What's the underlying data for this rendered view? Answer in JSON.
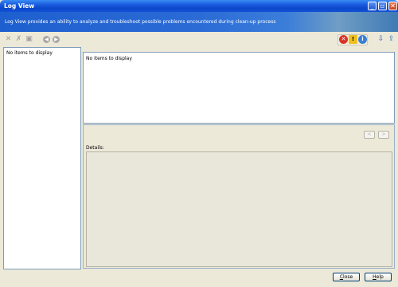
{
  "window": {
    "title": "Log View"
  },
  "banner": {
    "text": "Log View provides an ability to analyze and troubleshoot possible problems encountered during clean-up process"
  },
  "toolbar": {
    "icons": [
      "delete-icon",
      "delete-all-icon",
      "save-icon",
      "back-icon",
      "forward-icon"
    ],
    "filters": [
      "error-filter-icon",
      "warning-filter-icon",
      "info-filter-icon"
    ],
    "right_icons": [
      "import-icon",
      "export-icon"
    ]
  },
  "left_list": {
    "empty_text": "No items to display"
  },
  "log_list": {
    "empty_text": "No items to display"
  },
  "details": {
    "label": "Details:",
    "prev_label": "<",
    "next_label": ">"
  },
  "buttons": {
    "close_first": "C",
    "close_rest": "lose",
    "help_first": "H",
    "help_rest": "elp"
  },
  "colors": {
    "error": "#d8342a",
    "warning": "#f0c020",
    "info": "#3a7fd0"
  }
}
